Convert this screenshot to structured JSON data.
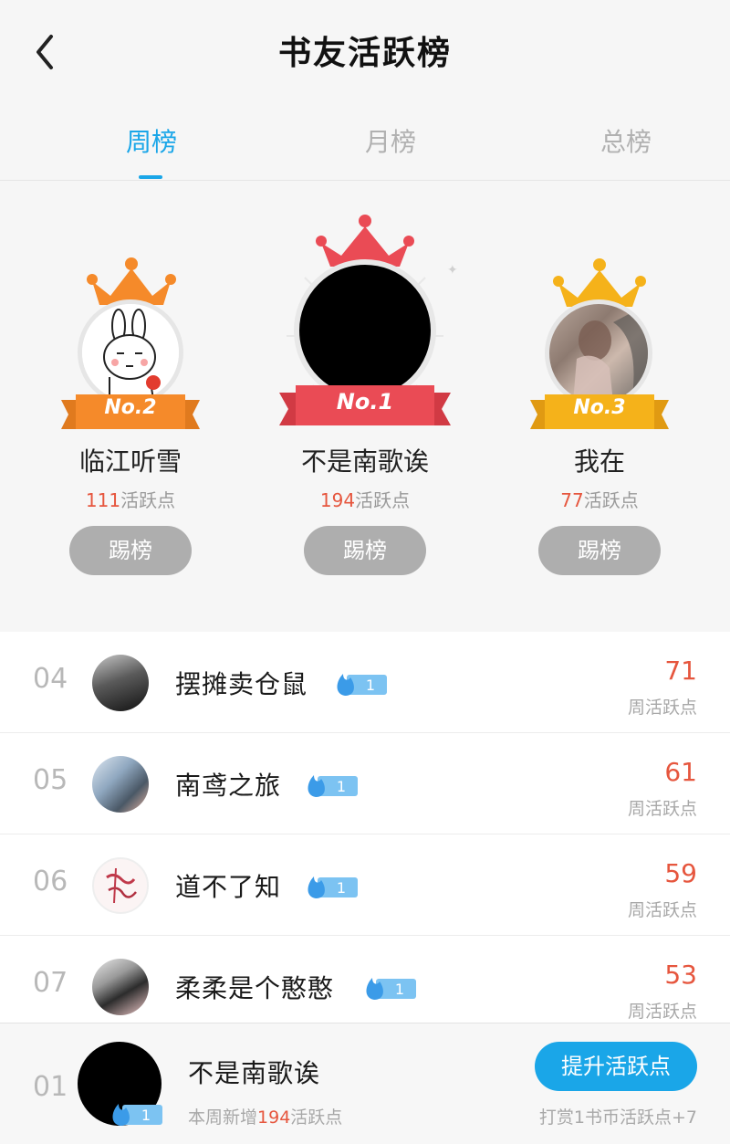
{
  "header": {
    "title": "书友活跃榜"
  },
  "tabs": [
    {
      "label": "周榜"
    },
    {
      "label": "月榜"
    },
    {
      "label": "总榜"
    }
  ],
  "podium": {
    "unit": "活跃点",
    "kick_label": "踢榜",
    "first": {
      "badge": "No.1",
      "name": "不是南歌诶",
      "points": "194"
    },
    "second": {
      "badge": "No.2",
      "name": "临江听雪",
      "points": "111"
    },
    "third": {
      "badge": "No.3",
      "name": "我在",
      "points": "77"
    }
  },
  "list": {
    "unit": "周活跃点",
    "items": [
      {
        "rank": "04",
        "name": "摆摊卖仓鼠",
        "level": "1",
        "score": "71"
      },
      {
        "rank": "05",
        "name": "南鸢之旅",
        "level": "1",
        "score": "61"
      },
      {
        "rank": "06",
        "name": "道不了知",
        "level": "1",
        "score": "59"
      },
      {
        "rank": "07",
        "name": "柔柔是个憨憨",
        "level": "1",
        "score": "53"
      }
    ]
  },
  "me": {
    "rank": "01",
    "name": "不是南歌诶",
    "level": "1",
    "sub_prefix": "本周新增",
    "sub_points": "194",
    "sub_suffix": "活跃点",
    "boost_label": "提升活跃点",
    "hint": "打赏1书币活跃点+7"
  },
  "colors": {
    "accent": "#1aa6e8",
    "score": "#e6563e",
    "gold": "#f5b21a",
    "orange": "#f58a2a",
    "red": "#ea4b55"
  }
}
